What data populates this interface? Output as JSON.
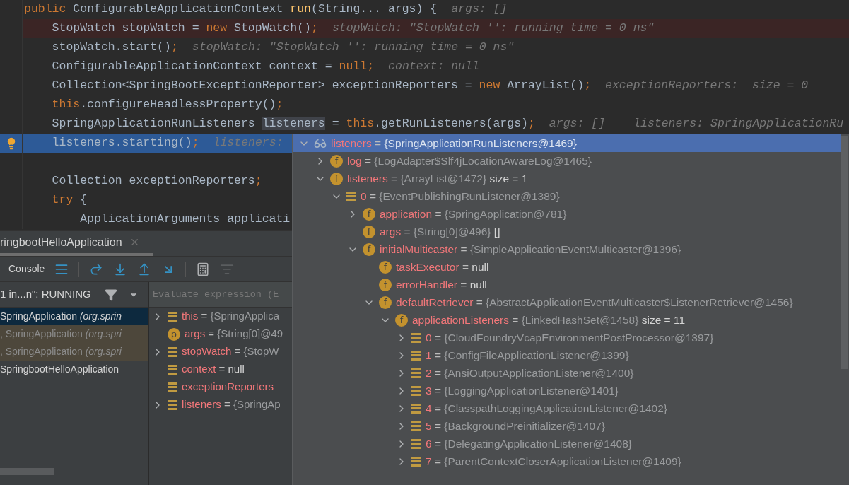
{
  "editor": {
    "lines": [
      {
        "breakpoint": false,
        "current": false,
        "code": [
          {
            "t": "public",
            "kind": "keyword"
          },
          {
            "t": " ConfigurableApplicationContext ",
            "kind": "plain"
          },
          {
            "t": "run",
            "kind": "method"
          },
          {
            "t": "(String... args) {",
            "kind": "plain"
          }
        ],
        "hints": [
          "args: []"
        ],
        "children": [
          {
            "breakpoint": true,
            "current": false,
            "code": [
              {
                "t": "StopWatch stopWatch = ",
                "kind": "plain"
              },
              {
                "t": "new",
                "kind": "keyword"
              },
              {
                "t": " StopWatch()",
                "kind": "plain"
              },
              {
                "t": ";",
                "kind": "keyword"
              }
            ],
            "hints": [
              "stopWatch: \"StopWatch '': running time = 0 ns\""
            ]
          },
          {
            "breakpoint": false,
            "current": false,
            "code": [
              {
                "t": "stopWatch.start()",
                "kind": "plain"
              },
              {
                "t": ";",
                "kind": "keyword"
              }
            ],
            "hints": [
              "stopWatch: \"StopWatch '': running time = 0 ns\""
            ]
          },
          {
            "breakpoint": false,
            "current": false,
            "code": [
              {
                "t": "ConfigurableApplicationContext context = ",
                "kind": "plain"
              },
              {
                "t": "null",
                "kind": "keyword"
              },
              {
                "t": ";",
                "kind": "keyword"
              }
            ],
            "hints": [
              "context: null"
            ]
          },
          {
            "breakpoint": false,
            "current": false,
            "code": [
              {
                "t": "Collection<SpringBootExceptionReporter> exceptionReporters = ",
                "kind": "plain"
              },
              {
                "t": "new",
                "kind": "keyword"
              },
              {
                "t": " ArrayList()",
                "kind": "plain"
              },
              {
                "t": ";",
                "kind": "keyword"
              }
            ],
            "hints": [
              "exceptionReporters:  size = 0"
            ]
          },
          {
            "breakpoint": false,
            "current": false,
            "code": [
              {
                "t": "this",
                "kind": "keyword"
              },
              {
                "t": ".configureHeadlessProperty()",
                "kind": "plain"
              },
              {
                "t": ";",
                "kind": "keyword"
              }
            ]
          },
          {
            "breakpoint": false,
            "current": false,
            "code": [
              {
                "t": "SpringApplicationRunListeners ",
                "kind": "plain"
              },
              {
                "t": "listeners",
                "kind": "highlight"
              },
              {
                "t": " = ",
                "kind": "plain"
              },
              {
                "t": "this",
                "kind": "keyword"
              },
              {
                "t": ".getRunListeners(args)",
                "kind": "plain"
              },
              {
                "t": ";",
                "kind": "keyword"
              }
            ],
            "hints": [
              "args: []",
              "listeners: SpringApplicationRu"
            ]
          },
          {
            "breakpoint": false,
            "current": true,
            "code": [
              {
                "t": "listeners.starting()",
                "kind": "plain"
              },
              {
                "t": ";",
                "kind": "keyword"
              }
            ],
            "hints": [
              "listeners:"
            ]
          },
          {
            "breakpoint": false,
            "current": false
          },
          {
            "breakpoint": false,
            "current": false,
            "code": [
              {
                "t": "Collection exceptionReporters",
                "kind": "plain"
              },
              {
                "t": ";",
                "kind": "keyword"
              }
            ]
          },
          {
            "breakpoint": false,
            "current": false,
            "code": [
              {
                "t": "try",
                "kind": "keyword"
              },
              {
                "t": " {",
                "kind": "plain"
              }
            ],
            "children": [
              {
                "breakpoint": false,
                "current": false,
                "code": [
                  {
                    "t": "ApplicationArguments applicati",
                    "kind": "plain"
                  }
                ]
              }
            ]
          }
        ]
      }
    ]
  },
  "debug_panel": {
    "tab": {
      "label": "ringbootHelloApplication",
      "selected": true
    },
    "toolbar": {
      "console": "Console"
    },
    "thread": "1 in...n\": RUNNING",
    "frames": [
      {
        "method": "SpringApplication",
        "location": "(org.sprin",
        "kind": "app",
        "selected": true
      },
      {
        "method": ", SpringApplication",
        "location": "(org.spri",
        "kind": "library",
        "selected": false
      },
      {
        "method": ", SpringApplication",
        "location": "(org.spri",
        "kind": "library",
        "selected": false
      },
      {
        "method": "SpringbootHelloApplication",
        "kind": "app",
        "selected": false
      }
    ],
    "evaluate": {
      "placeholder": "Evaluate expression (E"
    },
    "variables": [
      {
        "name": "this",
        "op": "=",
        "value": "{SpringApplica",
        "kind": "object",
        "expanded": false
      },
      {
        "name": "args",
        "op": "=",
        "value": "{String[0]@49",
        "kind": "parameter",
        "badge": "p"
      },
      {
        "name": "stopWatch",
        "op": "=",
        "value": "{StopW",
        "kind": "object",
        "expanded": false
      },
      {
        "name": "context",
        "op": "=",
        "extra": "null",
        "kind": "object"
      },
      {
        "name": "exceptionReporters",
        "kind": "object"
      },
      {
        "name": "listeners",
        "op": "=",
        "value": "{SpringAp",
        "kind": "object",
        "expanded": false
      }
    ]
  },
  "popup": {
    "tree": [
      {
        "name": "listeners",
        "op": "=",
        "value": "{SpringApplicationRunListeners@1469}",
        "kind": "watch",
        "expanded": true,
        "selected": true,
        "children": [
          {
            "name": "log",
            "op": "=",
            "value": "{LogAdapter$Slf4jLocationAwareLog@1465}",
            "kind": "field",
            "badge": "f",
            "expanded": false,
            "selected": false
          },
          {
            "name": "listeners",
            "op": "=",
            "value": "{ArrayList@1472}",
            "extra": "size = 1",
            "kind": "field",
            "badge": "f",
            "expanded": true,
            "selected": false,
            "children": [
              {
                "name": "0",
                "op": "=",
                "value": "{EventPublishingRunListener@1389}",
                "kind": "object",
                "expanded": true,
                "selected": false,
                "children": [
                  {
                    "name": "application",
                    "op": "=",
                    "value": "{SpringApplication@781}",
                    "kind": "field",
                    "badge": "f",
                    "expanded": false,
                    "selected": false
                  },
                  {
                    "name": "args",
                    "op": "=",
                    "value": "{String[0]@496}",
                    "extra": "[]",
                    "kind": "field",
                    "badge": "f",
                    "selected": false
                  },
                  {
                    "name": "initialMulticaster",
                    "op": "=",
                    "value": "{SimpleApplicationEventMulticaster@1396}",
                    "kind": "field",
                    "badge": "f",
                    "expanded": true,
                    "selected": false,
                    "children": [
                      {
                        "name": "taskExecutor",
                        "op": "=",
                        "extra": "null",
                        "kind": "field",
                        "badge": "f",
                        "selected": false
                      },
                      {
                        "name": "errorHandler",
                        "op": "=",
                        "extra": "null",
                        "kind": "field",
                        "badge": "f",
                        "selected": false
                      },
                      {
                        "name": "defaultRetriever",
                        "op": "=",
                        "value": "{AbstractApplicationEventMulticaster$ListenerRetriever@1456}",
                        "kind": "field",
                        "badge": "f",
                        "expanded": true,
                        "selected": false,
                        "children": [
                          {
                            "name": "applicationListeners",
                            "op": "=",
                            "value": "{LinkedHashSet@1458}",
                            "extra": "size = 11",
                            "kind": "field",
                            "badge": "f",
                            "expanded": true,
                            "selected": false,
                            "children": [
                              {
                                "name": "0",
                                "op": "=",
                                "value": "{CloudFoundryVcapEnvironmentPostProcessor@1397}",
                                "kind": "object",
                                "expanded": false,
                                "selected": false
                              },
                              {
                                "name": "1",
                                "op": "=",
                                "value": "{ConfigFileApplicationListener@1399}",
                                "kind": "object",
                                "expanded": false,
                                "selected": false
                              },
                              {
                                "name": "2",
                                "op": "=",
                                "value": "{AnsiOutputApplicationListener@1400}",
                                "kind": "object",
                                "expanded": false,
                                "selected": false
                              },
                              {
                                "name": "3",
                                "op": "=",
                                "value": "{LoggingApplicationListener@1401}",
                                "kind": "object",
                                "expanded": false,
                                "selected": false
                              },
                              {
                                "name": "4",
                                "op": "=",
                                "value": "{ClasspathLoggingApplicationListener@1402}",
                                "kind": "object",
                                "expanded": false,
                                "selected": false
                              },
                              {
                                "name": "5",
                                "op": "=",
                                "value": "{BackgroundPreinitializer@1407}",
                                "kind": "object",
                                "expanded": false,
                                "selected": false
                              },
                              {
                                "name": "6",
                                "op": "=",
                                "value": "{DelegatingApplicationListener@1408}",
                                "kind": "object",
                                "expanded": false,
                                "selected": false
                              },
                              {
                                "name": "7",
                                "op": "=",
                                "value": "{ParentContextCloserApplicationListener@1409}",
                                "kind": "object",
                                "expanded": false,
                                "selected": false
                              }
                            ]
                          }
                        ]
                      }
                    ]
                  }
                ]
              }
            ]
          }
        ]
      }
    ]
  }
}
